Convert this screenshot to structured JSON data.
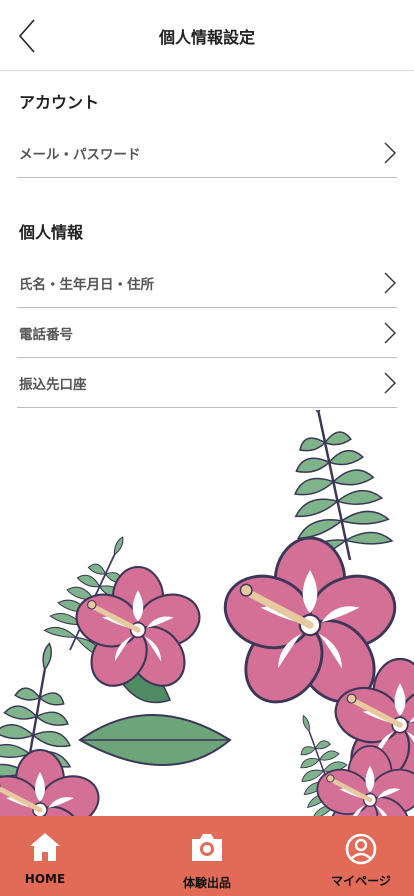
{
  "header": {
    "title": "個人情報設定",
    "back_icon": "chevron-left-icon"
  },
  "sections": [
    {
      "title": "アカウント",
      "items": [
        {
          "label": "メール・パスワード",
          "icon": "chevron-right-icon"
        }
      ]
    },
    {
      "title": "個人情報",
      "items": [
        {
          "label": "氏名・生年月日・住所",
          "icon": "chevron-right-icon"
        },
        {
          "label": "電話番号",
          "icon": "chevron-right-icon"
        },
        {
          "label": "振込先口座",
          "icon": "chevron-right-icon"
        }
      ]
    }
  ],
  "decoration": {
    "name": "hibiscus-tropical-illustration",
    "colors": {
      "petal": "#d46f95",
      "leaf": "#7fb38a",
      "outline": "#3c3658"
    }
  },
  "tabbar": {
    "background": "#e16b57",
    "tabs": [
      {
        "label": "HOME",
        "icon": "home-icon"
      },
      {
        "label": "体験出品",
        "icon": "camera-icon"
      },
      {
        "label": "マイページ",
        "icon": "user-circle-icon"
      }
    ]
  }
}
